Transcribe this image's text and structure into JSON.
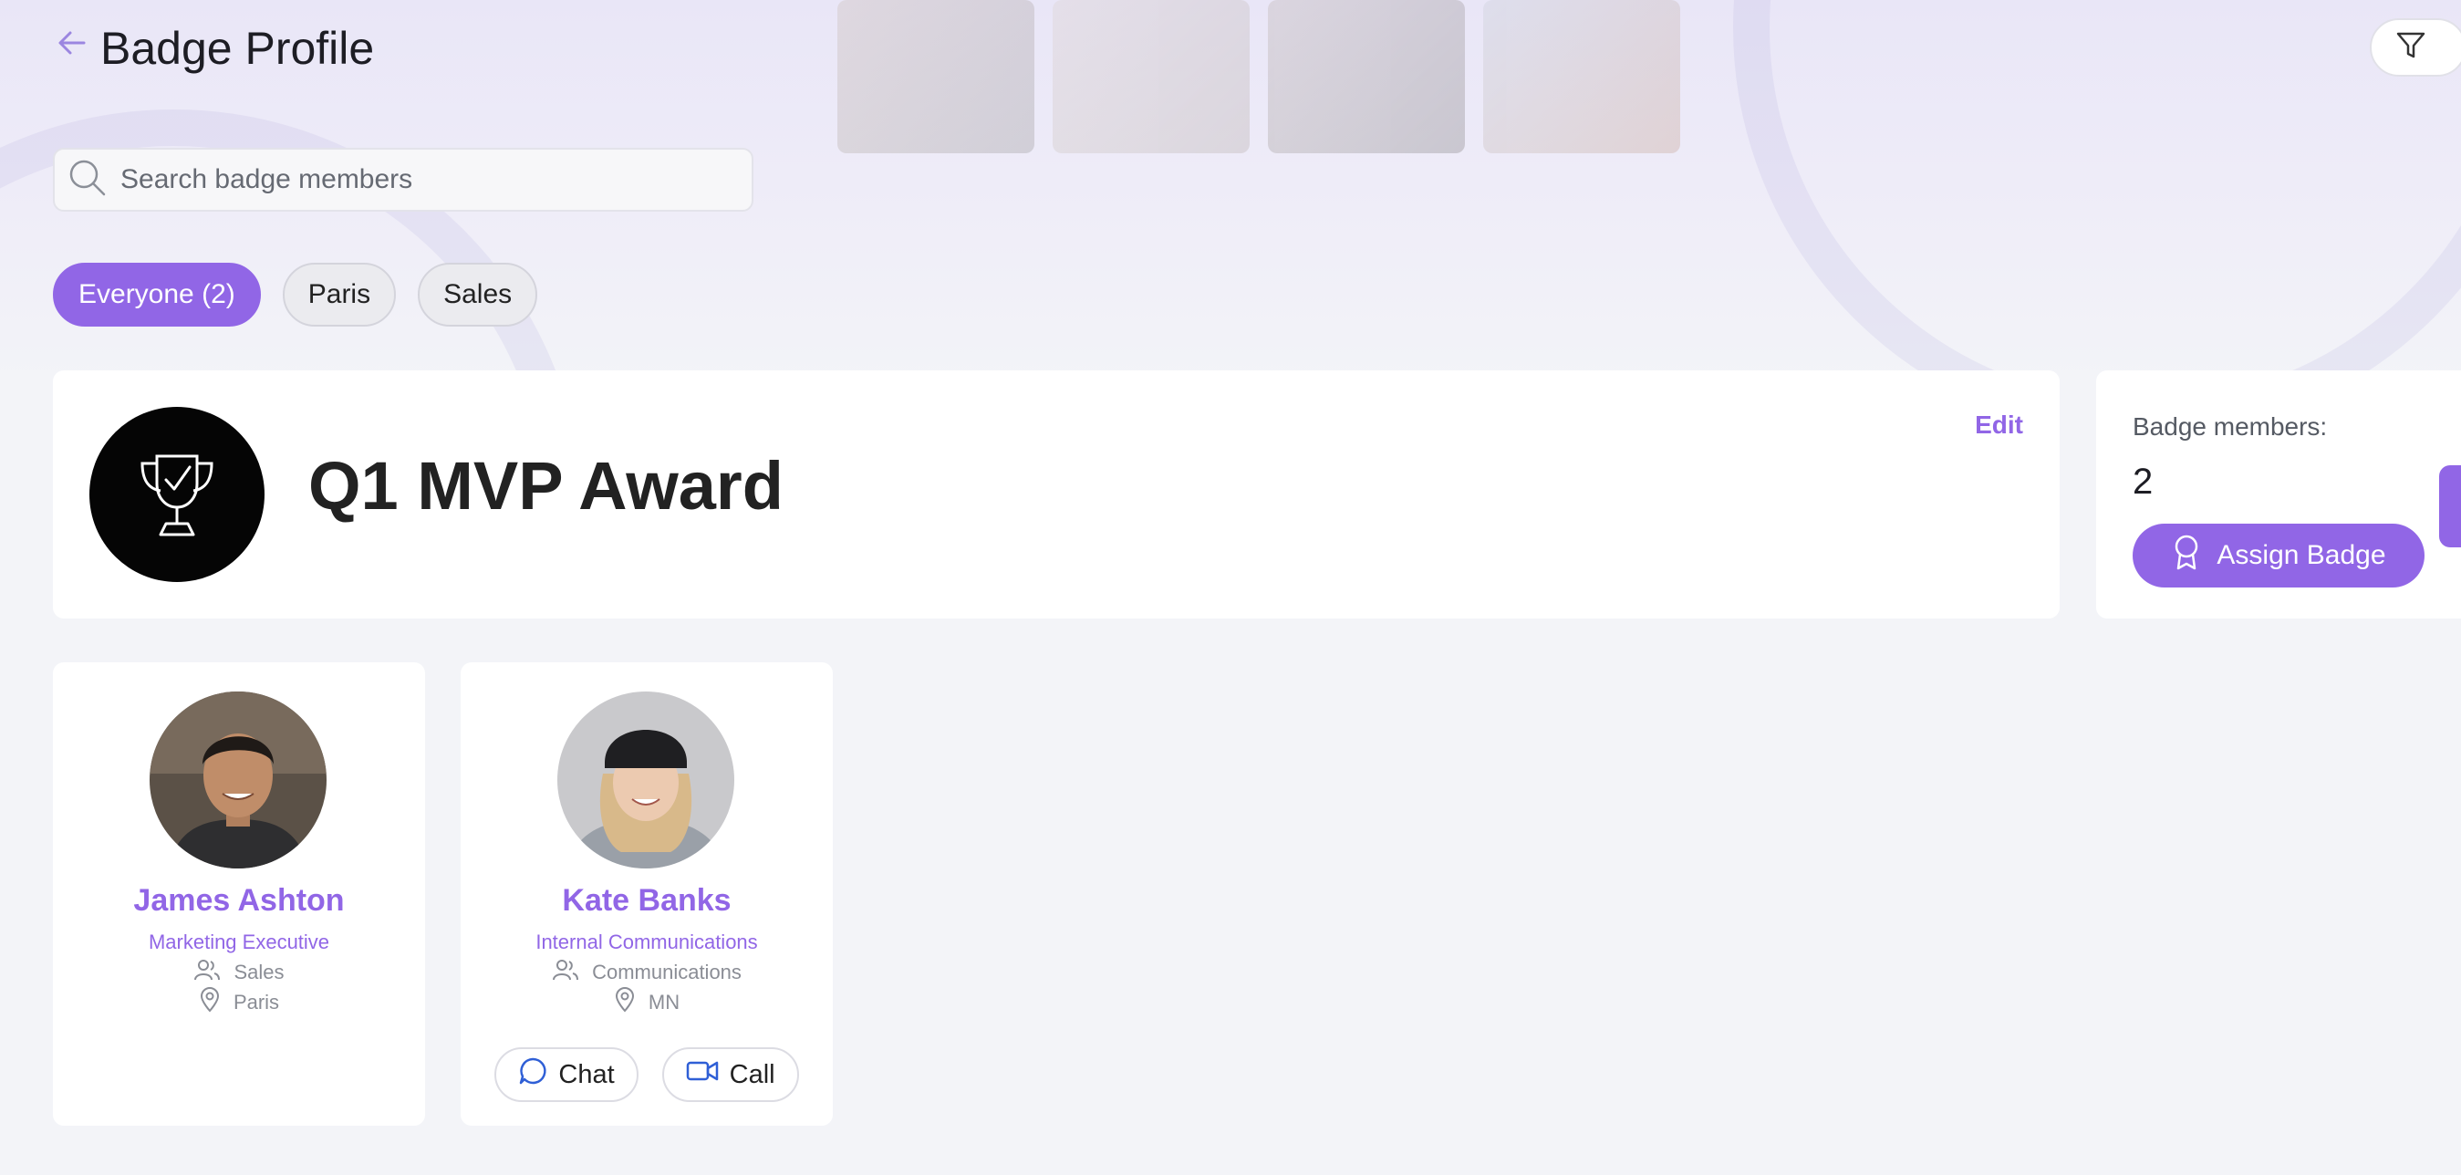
{
  "header": {
    "title": "Badge Profile",
    "back_icon": "arrow-left-icon",
    "filter_icon": "funnel-icon"
  },
  "search": {
    "placeholder": "Search badge members",
    "value": ""
  },
  "filters": [
    {
      "label": "Everyone (2)",
      "active": true
    },
    {
      "label": "Paris",
      "active": false
    },
    {
      "label": "Sales",
      "active": false
    }
  ],
  "badge": {
    "name": "Q1 MVP Award",
    "edit_label": "Edit",
    "icon": "trophy-check-icon"
  },
  "members_panel": {
    "label": "Badge members:",
    "count": "2",
    "assign_label": "Assign Badge",
    "assign_icon": "award-ribbon-icon"
  },
  "members": [
    {
      "name": "James Ashton",
      "role": "Marketing Executive",
      "department": "Sales",
      "location": "Paris"
    },
    {
      "name": "Kate Banks",
      "role": "Internal Communications",
      "department": "Communications",
      "location": "MN",
      "chat_label": "Chat",
      "call_label": "Call"
    }
  ],
  "colors": {
    "accent": "#9166e6",
    "background": "#f3f4f8",
    "card": "#ffffff",
    "action_icon": "#2f5fd6"
  }
}
